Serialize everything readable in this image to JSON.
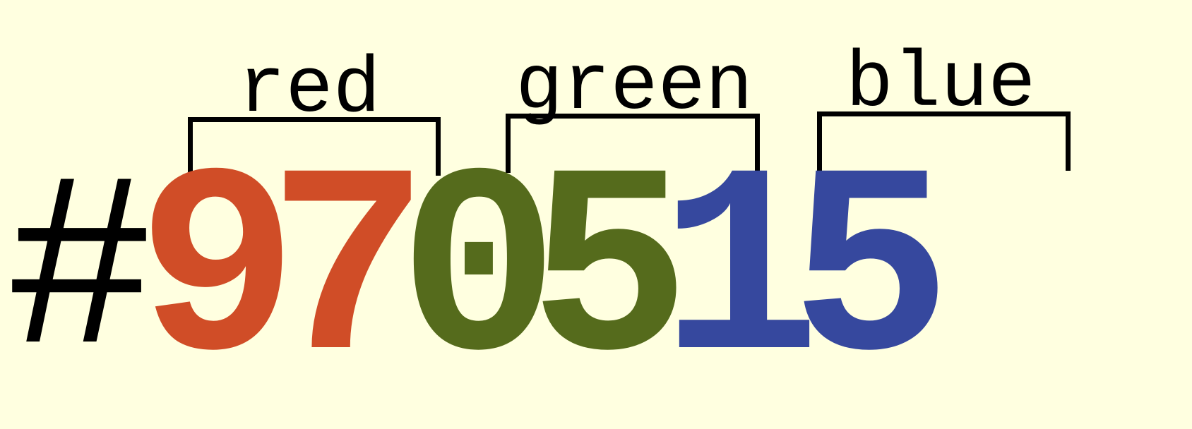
{
  "diagram": {
    "hash_symbol": "#",
    "channels": [
      {
        "name": "red",
        "digits": "97",
        "color": "#d04d27"
      },
      {
        "name": "green",
        "digits": "05",
        "color": "#556b1c"
      },
      {
        "name": "blue",
        "digits": "15",
        "color": "#36489e"
      }
    ],
    "hash_color": "#000000",
    "bracket_color": "#000000",
    "background_color": "#ffffe0"
  }
}
